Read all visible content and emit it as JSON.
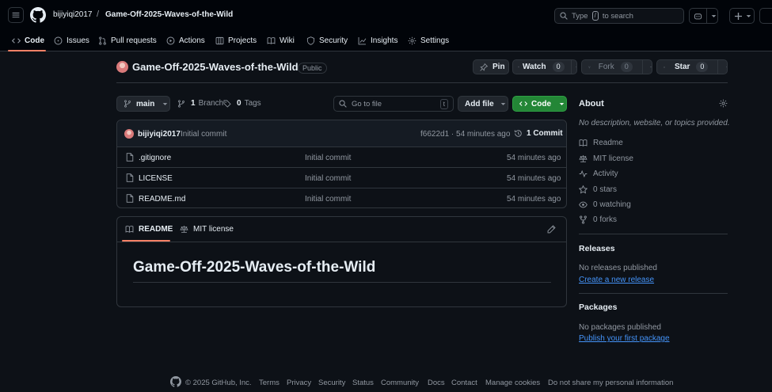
{
  "header": {
    "owner": "bijiyiqi2017",
    "separator": "/",
    "repo": "Game-Off-2025-Waves-of-the-Wild",
    "search_prefix": "Type",
    "search_key": "/",
    "search_suffix": "to search"
  },
  "tabs": [
    {
      "label": "Code",
      "icon": "code-icon"
    },
    {
      "label": "Issues",
      "icon": "issue-icon"
    },
    {
      "label": "Pull requests",
      "icon": "pull-request-icon"
    },
    {
      "label": "Actions",
      "icon": "play-icon"
    },
    {
      "label": "Projects",
      "icon": "table-icon"
    },
    {
      "label": "Wiki",
      "icon": "book-icon"
    },
    {
      "label": "Security",
      "icon": "shield-icon"
    },
    {
      "label": "Insights",
      "icon": "graph-icon"
    },
    {
      "label": "Settings",
      "icon": "gear-icon"
    }
  ],
  "repo_header": {
    "title": "Game-Off-2025-Waves-of-the-Wild",
    "visibility": "Public",
    "pin_label": "Pin",
    "watch_label": "Watch",
    "watch_count": "0",
    "fork_label": "Fork",
    "fork_count": "0",
    "star_label": "Star",
    "star_count": "0"
  },
  "file_nav": {
    "branch": "main",
    "branch_count": "1",
    "branch_label": "Branch",
    "tag_count": "0",
    "tag_label": "Tags",
    "goto_placeholder": "Go to file",
    "goto_key": "t",
    "add_file_label": "Add file",
    "code_label": "Code"
  },
  "commit": {
    "author": "bijiyiqi2017",
    "message": "Initial commit",
    "hash_time": "f6622d1 · 54 minutes ago",
    "commits_label": "1 Commit"
  },
  "files": [
    {
      "name": ".gitignore",
      "message": "Initial commit",
      "time": "54 minutes ago"
    },
    {
      "name": "LICENSE",
      "message": "Initial commit",
      "time": "54 minutes ago"
    },
    {
      "name": "README.md",
      "message": "Initial commit",
      "time": "54 minutes ago"
    }
  ],
  "readme": {
    "tab_readme": "README",
    "tab_license": "MIT license",
    "heading": "Game-Off-2025-Waves-of-the-Wild"
  },
  "about": {
    "title": "About",
    "description": "No description, website, or topics provided.",
    "items": [
      {
        "label": "Readme",
        "icon": "book-icon"
      },
      {
        "label": "MIT license",
        "icon": "law-icon"
      },
      {
        "label": "Activity",
        "icon": "pulse-icon"
      },
      {
        "label": "0 stars",
        "icon": "star-icon"
      },
      {
        "label": "0 watching",
        "icon": "eye-icon"
      },
      {
        "label": "0 forks",
        "icon": "fork-icon"
      }
    ]
  },
  "releases": {
    "title": "Releases",
    "empty": "No releases published",
    "link": "Create a new release"
  },
  "packages": {
    "title": "Packages",
    "empty": "No packages published",
    "link": "Publish your first package"
  },
  "footer": {
    "copyright": "© 2025 GitHub, Inc.",
    "links": [
      "Terms",
      "Privacy",
      "Security",
      "Status",
      "Community",
      "Docs",
      "Contact",
      "Manage cookies",
      "Do not share my personal information"
    ]
  },
  "colors": {
    "background": "#0d1117",
    "header": "#010409",
    "border": "#30363d",
    "accent_green": "#238636",
    "link_blue": "#4493f8",
    "tab_underline": "#f78166"
  }
}
